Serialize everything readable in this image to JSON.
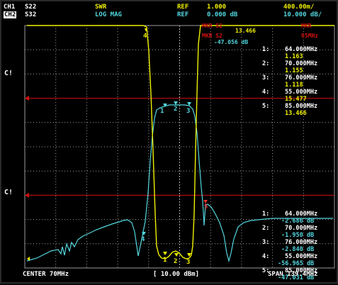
{
  "header": {
    "ch1": {
      "label": "CH1",
      "param": "S22",
      "format": "SWR",
      "ref_label": "REF",
      "ref_value": "1.000",
      "scale": "400.00m/"
    },
    "ch2": {
      "label": "CH2",
      "param": "S32",
      "format": "LOG MAG",
      "ref_label": "REF",
      "ref_value": "0.000 dB",
      "scale": "10.000 dB/"
    }
  },
  "overlay": {
    "mkr_swr": "13.466",
    "mkr_db": "-47.056 dB",
    "top_red_1": "MKR",
    "top_red_2": "85MHz",
    "hdr_mkr1": "MKR S2",
    "hdr_mkr2": "MKR S2"
  },
  "side_labels": {
    "upper": "C!",
    "lower": "C!"
  },
  "ch1_marker_table": [
    {
      "n": "1:",
      "freq": "64.000MHz",
      "val": "1.163"
    },
    {
      "n": "2:",
      "freq": "70.000MHz",
      "val": "1.155"
    },
    {
      "n": "3:",
      "freq": "76.000MHz",
      "val": "1.118"
    },
    {
      "n": "4:",
      "freq": "55.000MHz",
      "val": "15.477"
    },
    {
      "n": "5:",
      "freq": "85.000MHz",
      "val": "13.466"
    }
  ],
  "ch2_marker_table": [
    {
      "n": "1:",
      "freq": "64.000MHz",
      "val": "-2.686 dB"
    },
    {
      "n": "2:",
      "freq": "70.000MHz",
      "val": "-1.950 dB"
    },
    {
      "n": "3:",
      "freq": "76.000MHz",
      "val": "-2.840 dB"
    },
    {
      "n": "4:",
      "freq": "55.000MHz",
      "val": "-56.965 dB"
    },
    {
      "n": "5:",
      "freq": "85.000MHz",
      "val": "-47.031 dB"
    }
  ],
  "footer": {
    "center": "CENTER 70MHz",
    "power": "[ 10.00 dBm]",
    "span": "SPAN 139.4MHz"
  },
  "markers": {
    "yellow": [
      "4",
      "1",
      "2",
      "3"
    ],
    "cyan": [
      "1",
      "2",
      "3",
      "4"
    ],
    "red": "5"
  },
  "colors": {
    "ch1": "#f0f000",
    "ch2": "#52d6de",
    "grid": "#9a9a9a",
    "ref": "#d21010",
    "marker5": "#e23030",
    "bg": "#000000"
  }
}
